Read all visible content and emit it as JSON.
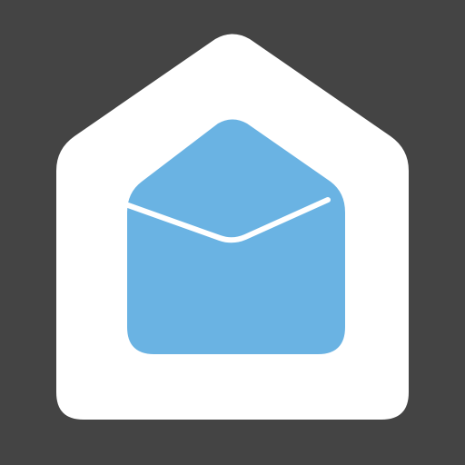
{
  "icon": {
    "name": "home-mail-icon",
    "parts": [
      "house-icon",
      "open-envelope-icon"
    ]
  },
  "colors": {
    "background": "#444444",
    "house": "#ffffff",
    "envelope": "#6ab3e3",
    "envelope_fold_line": "#ffffff"
  }
}
